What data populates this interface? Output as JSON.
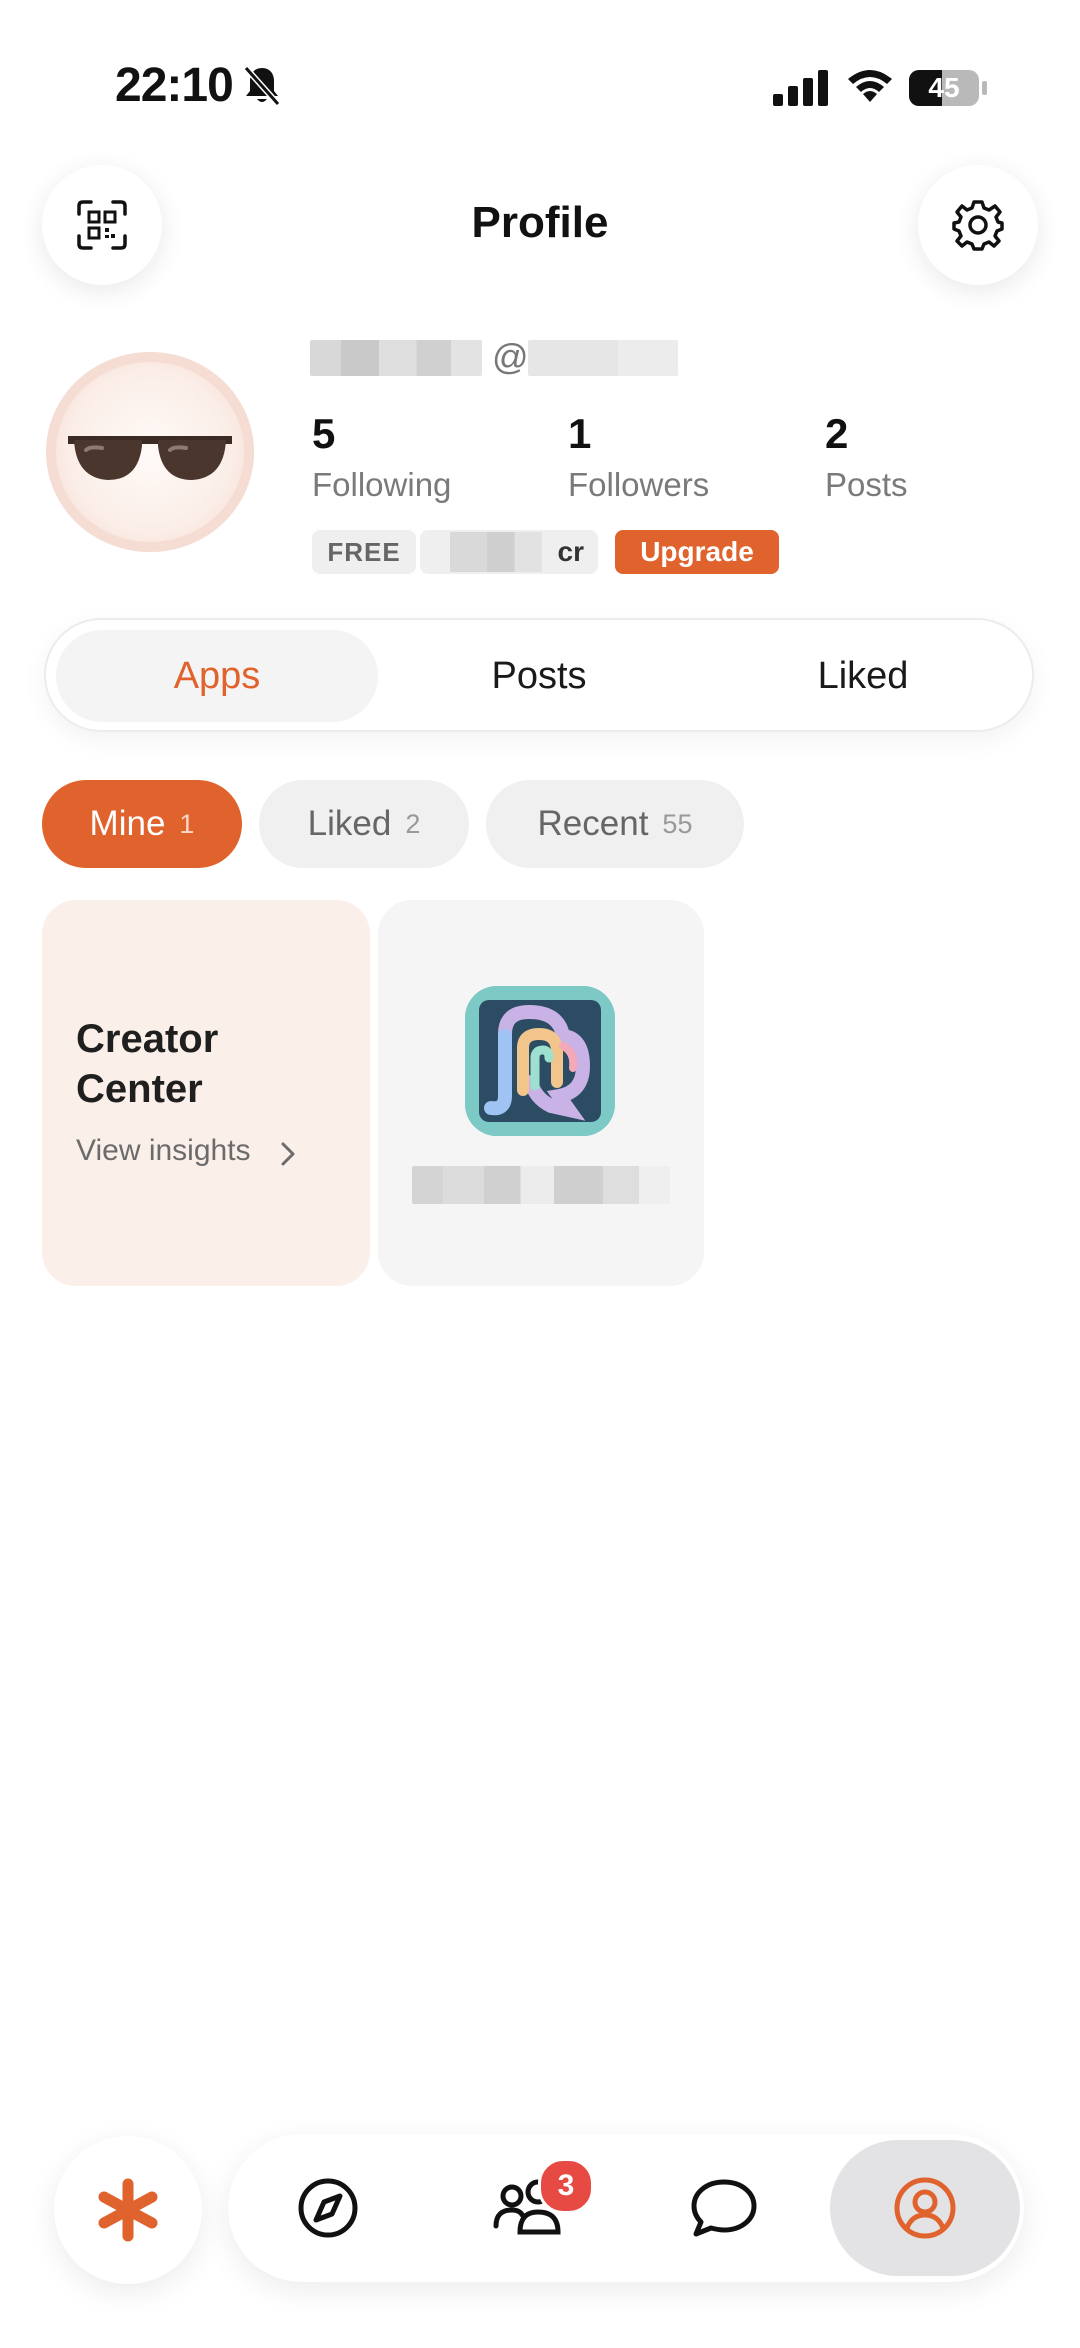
{
  "status_bar": {
    "time": "22:10",
    "battery": "45",
    "icons": [
      "bell-off-icon",
      "signal-icon",
      "wifi-icon",
      "battery-icon"
    ]
  },
  "header": {
    "title": "Profile",
    "left_icon": "qr-scan-icon",
    "right_icon": "gear-icon"
  },
  "profile": {
    "at": "@",
    "stats": [
      {
        "value": "5",
        "label": "Following"
      },
      {
        "value": "1",
        "label": "Followers"
      },
      {
        "value": "2",
        "label": "Posts"
      }
    ],
    "plan_badge": "FREE",
    "credits_suffix": "cr",
    "upgrade_label": "Upgrade"
  },
  "tabs": {
    "items": [
      "Apps",
      "Posts",
      "Liked"
    ],
    "active": "Apps"
  },
  "filters": [
    {
      "label": "Mine",
      "count": "1",
      "active": true
    },
    {
      "label": "Liked",
      "count": "2",
      "active": false
    },
    {
      "label": "Recent",
      "count": "55",
      "active": false
    }
  ],
  "cards": {
    "creator": {
      "title": "Creator Center",
      "link": "View insights"
    }
  },
  "bottom_nav": {
    "items": [
      "home-asterisk-icon",
      "explore-compass-icon",
      "community-icon",
      "chat-bubble-icon",
      "profile-icon"
    ],
    "community_badge": "3",
    "active": "profile-icon"
  },
  "colors": {
    "accent": "#e0622d",
    "creator_card_bg": "#fbefea",
    "badge": "#e64a43"
  }
}
